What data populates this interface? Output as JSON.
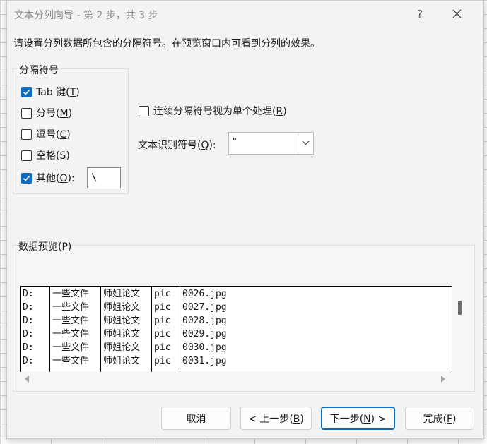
{
  "dialog": {
    "title": "文本分列向导 - 第 2 步，共 3 步",
    "help": "?",
    "instruction": "请设置分列数据所包含的分隔符号。在预览窗口内可看到分列的效果。"
  },
  "delimiters": {
    "group_title": "分隔符号",
    "items": [
      {
        "label": "Tab 键",
        "key": "T",
        "checked": true
      },
      {
        "label": "分号",
        "key": "M",
        "checked": false
      },
      {
        "label": "逗号",
        "key": "C",
        "checked": false
      },
      {
        "label": "空格",
        "key": "S",
        "checked": false
      },
      {
        "label": "其他",
        "key": "O",
        "checked": true,
        "suffix": ":"
      }
    ],
    "other_value": "\\"
  },
  "options": {
    "consecutive_label": "连续分隔符号视为单个处理",
    "consecutive_key": "R",
    "consecutive_checked": false,
    "qualifier_label": "文本识别符号",
    "qualifier_key": "Q",
    "qualifier_value": "\""
  },
  "preview": {
    "label": "数据预览",
    "label_key": "P",
    "rows": [
      [
        "D:",
        "一些文件",
        "师姐论文",
        "pic",
        "0026.jpg"
      ],
      [
        "D:",
        "一些文件",
        "师姐论文",
        "pic",
        "0027.jpg"
      ],
      [
        "D:",
        "一些文件",
        "师姐论文",
        "pic",
        "0028.jpg"
      ],
      [
        "D:",
        "一些文件",
        "师姐论文",
        "pic",
        "0029.jpg"
      ],
      [
        "D:",
        "一些文件",
        "师姐论文",
        "pic",
        "0030.jpg"
      ],
      [
        "D:",
        "一些文件",
        "师姐论文",
        "pic",
        "0031.jpg"
      ]
    ]
  },
  "buttons": {
    "cancel": "取消",
    "back_prefix": "< 上一步",
    "back_key": "B",
    "next_prefix": "下一步",
    "next_key": "N",
    "next_suffix": " >",
    "finish_prefix": "完成",
    "finish_key": "F"
  },
  "colors": {
    "accent": "#0f6cbd",
    "dialog_bg": "#f3f3f3"
  }
}
